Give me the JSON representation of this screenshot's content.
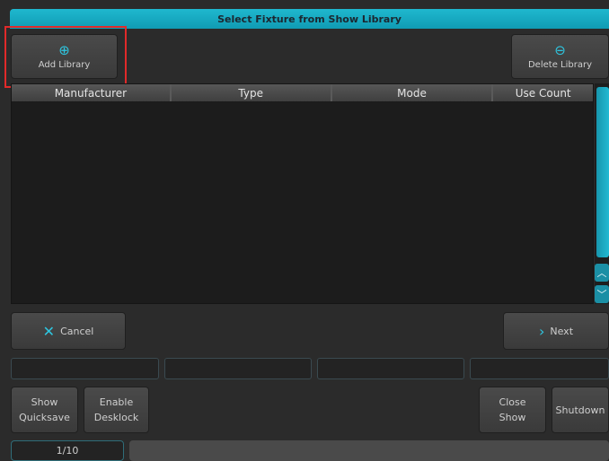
{
  "dialog": {
    "title": "Select Fixture from Show Library"
  },
  "toolbar": {
    "add_label": "Add Library",
    "add_icon": "plus-circle-icon",
    "delete_label": "Delete Library",
    "delete_icon": "minus-circle-icon"
  },
  "table": {
    "columns": [
      "Manufacturer",
      "Type",
      "Mode",
      "Use Count"
    ],
    "rows": []
  },
  "actions": {
    "cancel_label": "Cancel",
    "next_label": "Next"
  },
  "command_fields": [
    "",
    "",
    "",
    ""
  ],
  "bottom_buttons": {
    "show_quicksave": [
      "Show",
      "Quicksave"
    ],
    "enable_desklock": [
      "Enable",
      "Desklock"
    ],
    "close_show": [
      "Close",
      "Show"
    ],
    "shutdown": "Shutdown"
  },
  "page_indicator": "1/10",
  "colors": {
    "accent": "#1fb8cf",
    "highlight": "#e12a2a"
  }
}
